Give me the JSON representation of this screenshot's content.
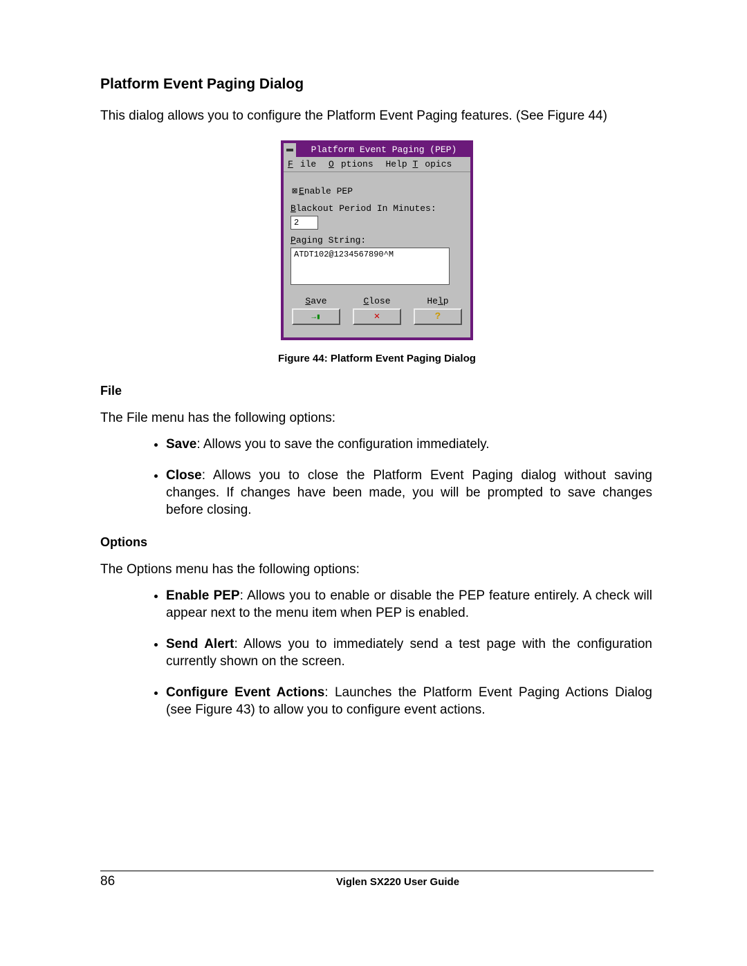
{
  "heading": "Platform Event Paging Dialog",
  "intro": "This dialog allows you to configure the Platform Event Paging features.  (See Figure 44)",
  "dialog": {
    "title": "Platform Event Paging (PEP)",
    "menu": {
      "file": "File",
      "options": "Options",
      "help_topics": "Help Topics"
    },
    "enable_label": "Enable PEP",
    "enable_checked_glyph": "⊠",
    "blackout_label": "Blackout Period In Minutes:",
    "blackout_value": "2",
    "paging_label": "Paging String:",
    "paging_value": "ATDT102@1234567890^M",
    "buttons": {
      "save": "Save",
      "close": "Close",
      "help": "Help"
    }
  },
  "figure_caption": "Figure 44:  Platform Event Paging Dialog",
  "file_section": {
    "head": "File",
    "lead": "The File menu has the following options:",
    "items": [
      {
        "term": "Save",
        "desc": ":  Allows you to save the configuration immediately."
      },
      {
        "term": "Close",
        "desc": ":  Allows you to close the Platform Event Paging dialog without saving changes.  If changes have been made, you will be prompted to save changes before closing."
      }
    ]
  },
  "options_section": {
    "head": "Options",
    "lead": "The Options menu has the following options:",
    "items": [
      {
        "term": "Enable PEP",
        "desc": ":  Allows you to enable or disable the PEP feature entirely.  A check will appear next to the menu item when PEP is enabled."
      },
      {
        "term": "Send Alert",
        "desc": ":   Allows you to immediately send a test page with the configuration currently shown on the screen."
      },
      {
        "term": "Configure Event Actions",
        "desc": ":  Launches the Platform Event Paging Actions Dialog (see Figure 43) to allow you to configure event actions."
      }
    ]
  },
  "footer": {
    "page": "86",
    "title": "Viglen SX220 User Guide"
  }
}
